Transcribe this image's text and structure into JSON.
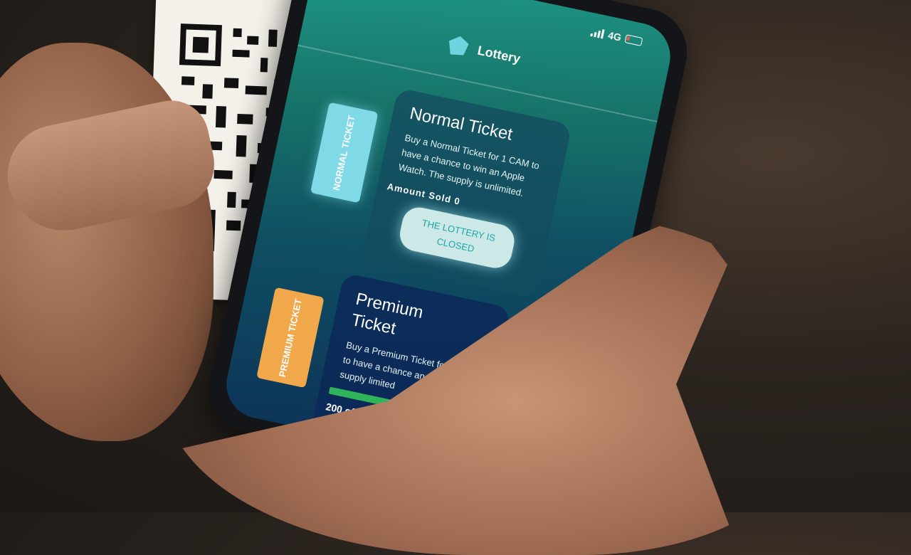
{
  "app": {
    "title": "Lottery",
    "status": {
      "network": "4G"
    }
  },
  "normal_ticket": {
    "title": "Normal Ticket",
    "description": "Buy a Normal Ticket for 1 CAM to have a chance to win an Apple Watch. The supply is unlimited.",
    "amount_label": "Amount Sold 0",
    "button_label": "THE LOTTERY IS CLOSED",
    "graphic_label": "NORMAL TICKET"
  },
  "premium_ticket": {
    "title": "Premium Ticket",
    "description": "Buy a Premium Ticket for CAM to have a chance an iPad. The supply limited",
    "sold_label": "200 of 2",
    "graphic_label": "PREMIUM TICKET"
  },
  "colors": {
    "screen_teal": "#1f9a88",
    "screen_navy": "#0c2d55",
    "normal_ticket": "#7fd9e6",
    "premium_ticket": "#f0a84a",
    "progress": "#2fb45a"
  }
}
